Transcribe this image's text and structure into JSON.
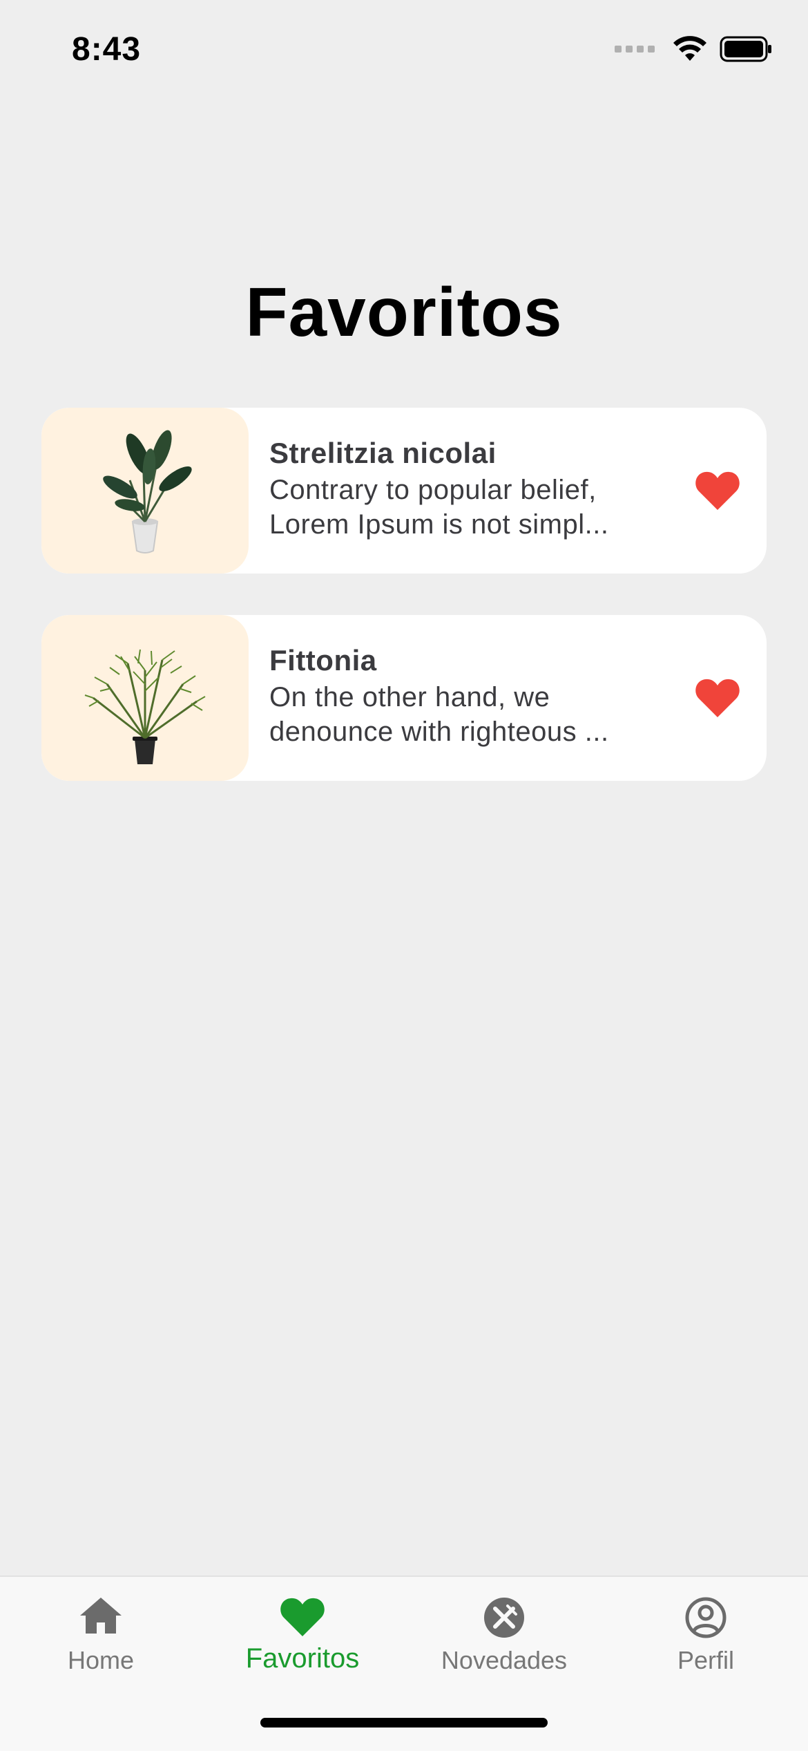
{
  "status_bar": {
    "time": "8:43"
  },
  "page": {
    "title": "Favoritos"
  },
  "favorites": [
    {
      "name": "Strelitzia nicolai",
      "description_line1": "Contrary to popular belief,",
      "description_line2": "Lorem Ipsum is not simpl...",
      "favorited": true
    },
    {
      "name": "Fittonia",
      "description_line1": "On the other hand, we",
      "description_line2": "denounce with righteous ...",
      "favorited": true
    }
  ],
  "tab_bar": {
    "tabs": [
      {
        "label": "Home",
        "icon": "home-icon",
        "active": false
      },
      {
        "label": "Favoritos",
        "icon": "heart-icon",
        "active": true
      },
      {
        "label": "Novedades",
        "icon": "news-icon",
        "active": false
      },
      {
        "label": "Perfil",
        "icon": "profile-icon",
        "active": false
      }
    ]
  },
  "colors": {
    "background": "#eeeeee",
    "card": "#ffffff",
    "thumb_bg": "#fff2e0",
    "heart_red": "#f0443a",
    "accent_green": "#1a9b2e",
    "tab_inactive": "#777777"
  }
}
